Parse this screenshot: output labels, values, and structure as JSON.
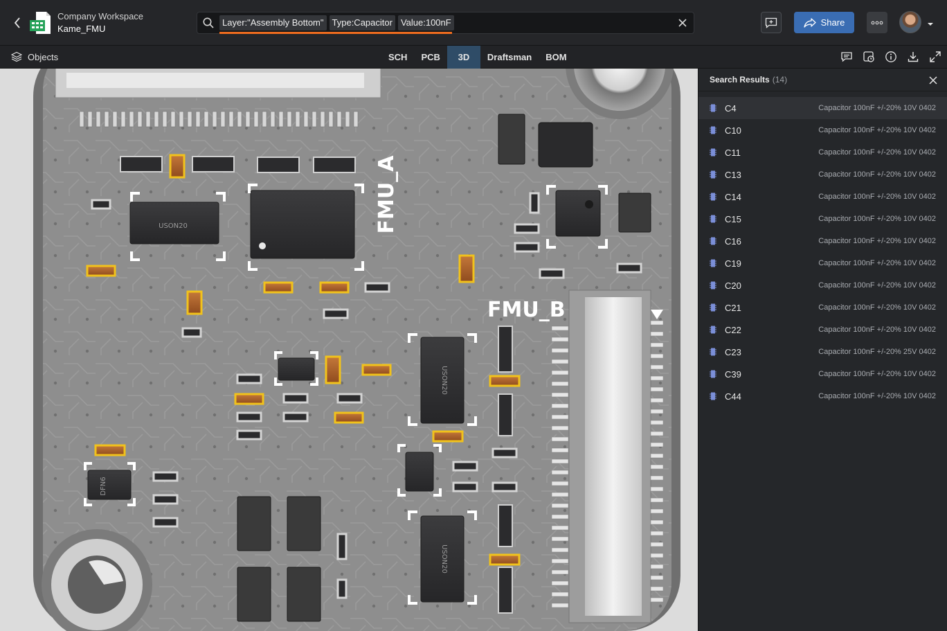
{
  "header": {
    "workspace": "Company Workspace",
    "project": "Kame_FMU",
    "search_chips": [
      "Layer:\"Assembly Bottom\"",
      "Type:Capacitor",
      "Value:100nF"
    ],
    "share_label": "Share"
  },
  "toolbar": {
    "objects_label": "Objects",
    "tabs": [
      "SCH",
      "PCB",
      "3D",
      "Draftsman",
      "BOM"
    ],
    "active_tab": "3D"
  },
  "board": {
    "labels": {
      "fmu_a": "FMU_A",
      "fmu_b": "FMU_B",
      "uson_1": "USON20",
      "uson_2": "USON20",
      "uson_3": "USON20",
      "dfn": "DFN6"
    }
  },
  "panel": {
    "title": "Search Results",
    "count": "(14)",
    "results": [
      {
        "designator": "C4",
        "description": "Capacitor 100nF +/-20% 10V 0402"
      },
      {
        "designator": "C10",
        "description": "Capacitor 100nF +/-20% 10V 0402"
      },
      {
        "designator": "C11",
        "description": "Capacitor 100nF +/-20% 10V 0402"
      },
      {
        "designator": "C13",
        "description": "Capacitor 100nF +/-20% 10V 0402"
      },
      {
        "designator": "C14",
        "description": "Capacitor 100nF +/-20% 10V 0402"
      },
      {
        "designator": "C15",
        "description": "Capacitor 100nF +/-20% 10V 0402"
      },
      {
        "designator": "C16",
        "description": "Capacitor 100nF +/-20% 10V 0402"
      },
      {
        "designator": "C19",
        "description": "Capacitor 100nF +/-20% 10V 0402"
      },
      {
        "designator": "C20",
        "description": "Capacitor 100nF +/-20% 10V 0402"
      },
      {
        "designator": "C21",
        "description": "Capacitor 100nF +/-20% 10V 0402"
      },
      {
        "designator": "C22",
        "description": "Capacitor 100nF +/-20% 10V 0402"
      },
      {
        "designator": "C23",
        "description": "Capacitor 100nF +/-20% 25V 0402"
      },
      {
        "designator": "C39",
        "description": "Capacitor 100nF +/-20% 10V 0402"
      },
      {
        "designator": "C44",
        "description": "Capacitor 100nF +/-20% 10V 0402"
      }
    ]
  },
  "colors": {
    "accent": "#ef6c1e",
    "share": "#3a6db3",
    "active_tab": "#2f4c67",
    "board": "#8f8f8f",
    "capacitor": "#b0622a",
    "highlight": "#f1c21b"
  }
}
